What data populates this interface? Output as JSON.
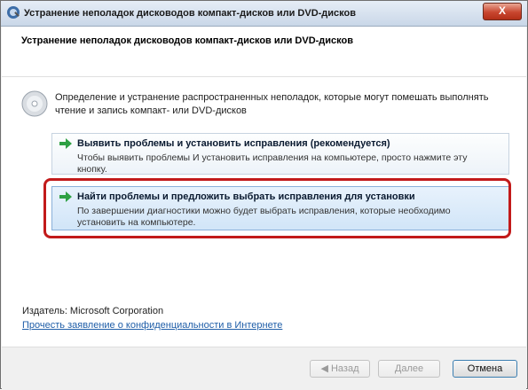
{
  "window": {
    "title": "Устранение неполадок дисководов компакт-дисков или DVD-дисков",
    "close_label": "X"
  },
  "header": {
    "title": "Устранение неполадок дисководов компакт-дисков или DVD-дисков"
  },
  "main": {
    "description": "Определение и устранение распространенных неполадок, которые могут помешать выполнять чтение и запись компакт- или DVD-дисков",
    "options": [
      {
        "title": "Выявить проблемы и установить исправления (рекомендуется)",
        "description": "Чтобы выявить проблемы И установить исправления на компьютере, просто нажмите эту кнопку."
      },
      {
        "title": "Найти проблемы и предложить выбрать исправления для установки",
        "description": "По завершении диагностики можно будет выбрать исправления, которые необходимо установить на компьютере."
      }
    ],
    "publisher": "Издатель: Microsoft Corporation",
    "privacy_link": "Прочесть заявление о конфиденциальности в Интернете"
  },
  "footer": {
    "back_label": "Назад",
    "next_label": "Далее",
    "cancel_label": "Отмена"
  },
  "colors": {
    "highlight": "#c21a1a",
    "link": "#1f5ea8",
    "arrow": "#2ea043"
  }
}
